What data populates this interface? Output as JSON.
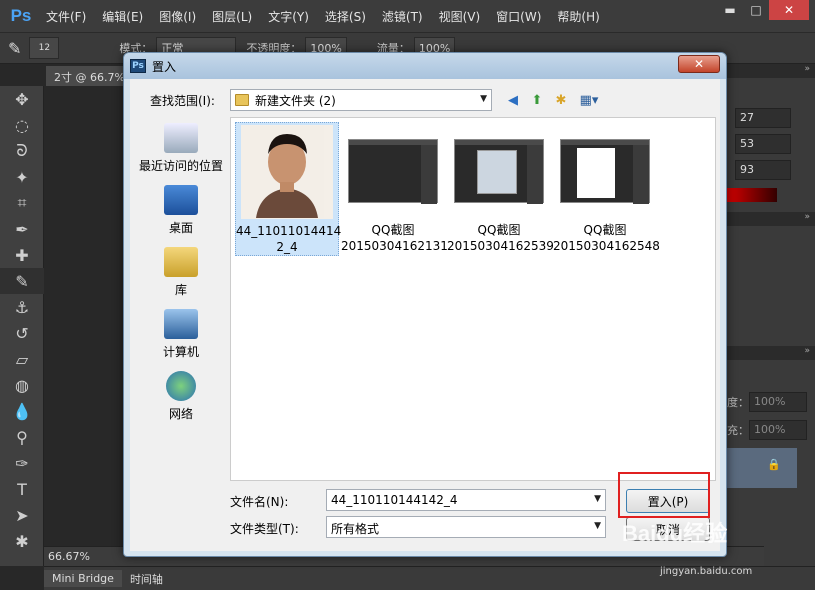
{
  "app": {
    "logo": "Ps",
    "menus": [
      "文件(F)",
      "编辑(E)",
      "图像(I)",
      "图层(L)",
      "文字(Y)",
      "选择(S)",
      "滤镜(T)",
      "视图(V)",
      "窗口(W)",
      "帮助(H)"
    ],
    "window_buttons": {
      "minimize": "▬",
      "restore": "□",
      "close": "✕"
    }
  },
  "options_bar": {
    "brush_size": "12",
    "mode_label": "模式：",
    "mode_value": "正常",
    "opacity_label": "不透明度：",
    "opacity_value": "100%",
    "flow_label": "流量：",
    "flow_value": "100%"
  },
  "document": {
    "tab_label": "2寸 @ 66.7%"
  },
  "right_panel": {
    "field1": "27",
    "field2": "53",
    "field3": "93",
    "opacity_value": "100%",
    "fill_value": "100%",
    "opacity_label": "度：",
    "fill_label": "充："
  },
  "status_bar": {
    "zoom": "66.67%"
  },
  "bottom_tabs": {
    "mini_bridge": "Mini Bridge",
    "timeline": "时间轴"
  },
  "dialog": {
    "title": "置入",
    "close_label": "✕",
    "look_in_label": "查找范围(I):",
    "look_in_value": "新建文件夹 (2)",
    "places": [
      {
        "label": "最近访问的位置",
        "icon": "recent-places-icon"
      },
      {
        "label": "桌面",
        "icon": "desktop-icon"
      },
      {
        "label": "库",
        "icon": "libraries-icon"
      },
      {
        "label": "计算机",
        "icon": "computer-icon"
      },
      {
        "label": "网络",
        "icon": "network-icon"
      }
    ],
    "files": [
      {
        "name_line1": "44_11011014414",
        "name_line2": "2_4",
        "type": "photo",
        "selected": true
      },
      {
        "name_line1": "QQ截图",
        "name_line2": "20150304162131",
        "type": "screenshot"
      },
      {
        "name_line1": "QQ截图",
        "name_line2": "20150304162539",
        "type": "screenshot"
      },
      {
        "name_line1": "QQ截图",
        "name_line2": "20150304162548",
        "type": "screenshot-white"
      }
    ],
    "filename_label": "文件名(N):",
    "filename_value": "44_110110144142_4",
    "filetype_label": "文件类型(T):",
    "filetype_value": "所有格式",
    "place_button": "置入(P)",
    "cancel_button": "取消"
  },
  "watermark": {
    "text": "Baidu经验",
    "sub": "jingyan.baidu.com"
  },
  "colors": {
    "ps_bg": "#282828",
    "dialog_frame": "#d6e4ef",
    "highlight": "#e02020"
  }
}
